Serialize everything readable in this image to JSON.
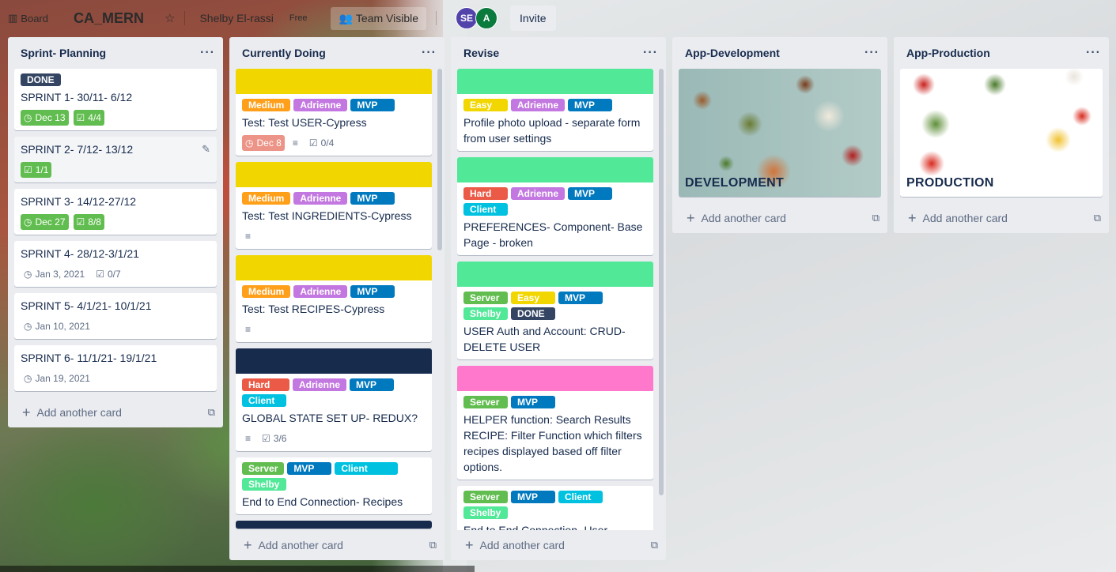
{
  "topbar": {
    "board_label": "Board",
    "board_title": "CA_MERN",
    "owner": "Shelby El-rassi",
    "plan": "Free",
    "visibility": "Team Visible",
    "avatars": [
      "SE",
      "A"
    ],
    "invite": "Invite"
  },
  "add_card_label": "Add another card",
  "colors": {
    "done": "#344563",
    "green": "#61bd4f",
    "orange": "#ff9f1a",
    "purple": "#c377e0",
    "blue": "#0079bf",
    "red": "#eb5a46",
    "sky": "#00c2e0",
    "lime": "#51e898",
    "yellow": "#f2d600",
    "navy": "#172b4d",
    "pink": "#ff78cb"
  },
  "lists": [
    {
      "title": "Sprint- Planning",
      "cards": [
        {
          "labels": [
            "DONE"
          ],
          "title": "SPRINT 1- 30/11- 6/12",
          "due": "Dec 13",
          "checklist": "4/4"
        },
        {
          "title": "SPRINT 2- 7/12- 13/12",
          "checklist": "1/1"
        },
        {
          "title": "SPRINT 3- 14/12-27/12",
          "due": "Dec 27",
          "checklist": "8/8"
        },
        {
          "title": "SPRINT 4- 28/12-3/1/21",
          "due": "Jan 3, 2021",
          "checklist": "0/7"
        },
        {
          "title": "SPRINT 5- 4/1/21- 10/1/21",
          "due": "Jan 10, 2021"
        },
        {
          "title": "SPRINT 6- 11/1/21- 19/1/21",
          "due": "Jan 19, 2021"
        }
      ]
    },
    {
      "title": "Currently Doing",
      "cards": [
        {
          "labels": [
            "Medium",
            "Adrienne",
            "MVP"
          ],
          "title": "Test: Test USER-Cypress",
          "due": "Dec 8",
          "checklist": "0/4"
        },
        {
          "labels": [
            "Medium",
            "Adrienne",
            "MVP"
          ],
          "title": "Test: Test INGREDIENTS-Cypress"
        },
        {
          "labels": [
            "Medium",
            "Adrienne",
            "MVP"
          ],
          "title": "Test: Test RECIPES-Cypress"
        },
        {
          "labels": [
            "Hard",
            "Adrienne",
            "MVP",
            "Client"
          ],
          "title": "GLOBAL STATE SET UP- REDUX?",
          "checklist": "3/6"
        },
        {
          "labels": [
            "Server",
            "MVP",
            "Client",
            "Shelby"
          ],
          "title": "End to End Connection- Recipes"
        }
      ]
    },
    {
      "title": "Revise",
      "cards": [
        {
          "labels": [
            "Easy",
            "Adrienne",
            "MVP"
          ],
          "title": "Profile photo upload - separate form from user settings"
        },
        {
          "labels": [
            "Hard",
            "Adrienne",
            "MVP",
            "Client"
          ],
          "title": "PREFERENCES- Component- Base Page - broken"
        },
        {
          "labels": [
            "Server",
            "Easy",
            "MVP",
            "Shelby",
            "DONE"
          ],
          "title": "USER Auth and Account: CRUD- DELETE USER"
        },
        {
          "labels": [
            "Server",
            "MVP"
          ],
          "title": "HELPER function: Search Results RECIPE: Filter Function which filters recipes displayed based off filter options."
        },
        {
          "labels": [
            "Server",
            "MVP",
            "Client",
            "Shelby"
          ],
          "title": "End to End Connection- User"
        }
      ]
    },
    {
      "title": "App-Development",
      "cards": [
        {
          "title": "DEVELOPMENT"
        }
      ]
    },
    {
      "title": "App-Production",
      "cards": [
        {
          "title": "PRODUCTION"
        }
      ]
    }
  ]
}
